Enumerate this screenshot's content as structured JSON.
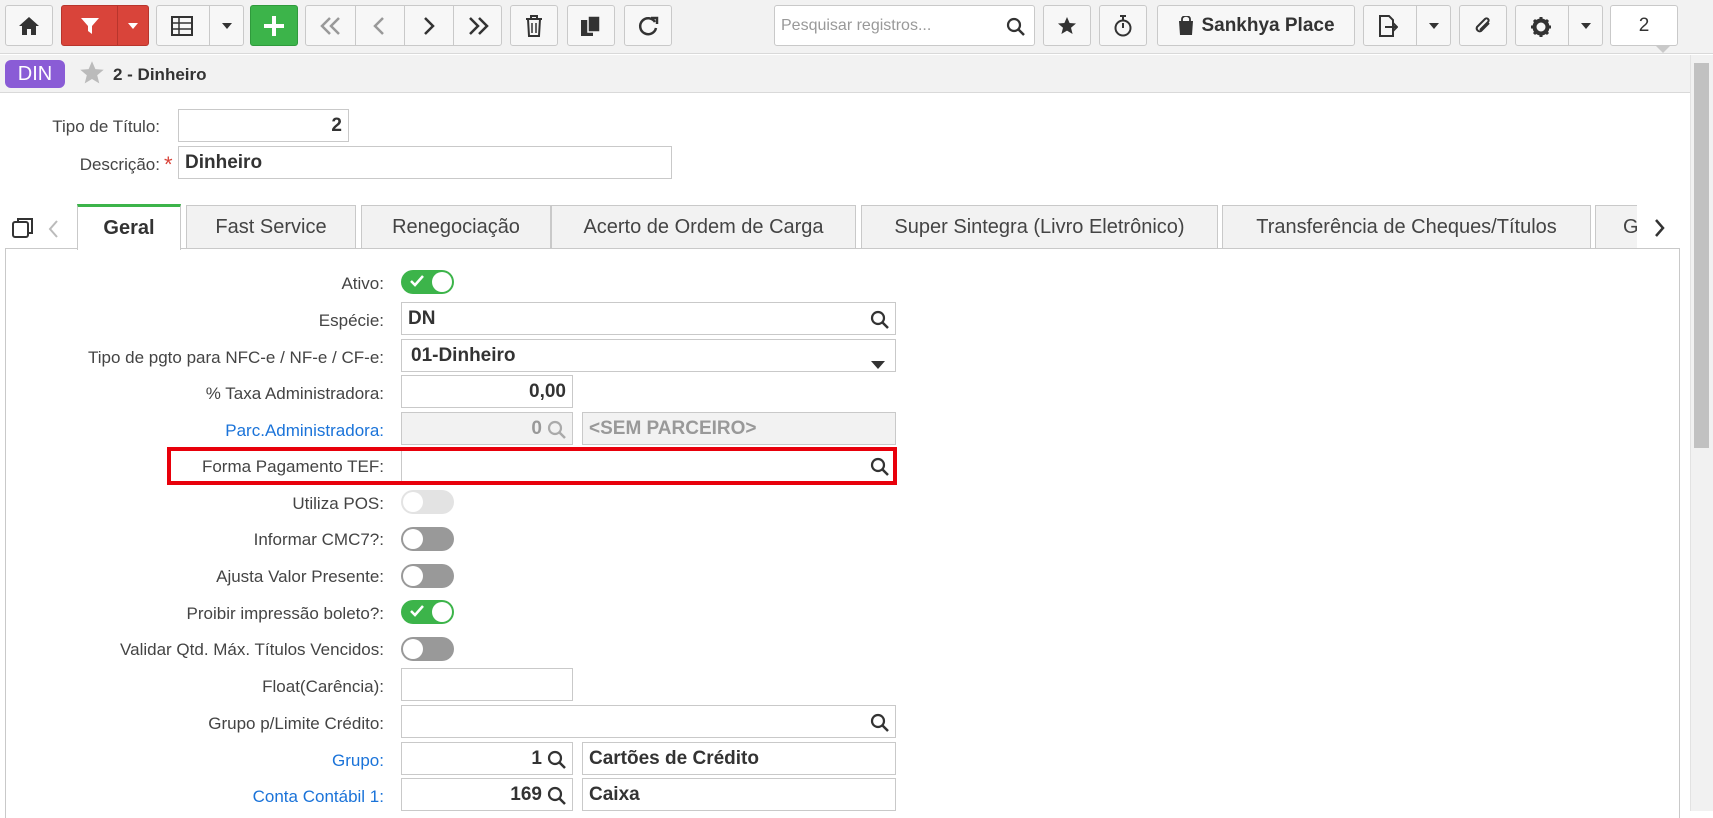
{
  "toolbar": {
    "search_placeholder": "Pesquisar registros...",
    "place_label": "Sankhya Place",
    "page_number": "2"
  },
  "record": {
    "badge": "DIN",
    "title": "2 - Dinheiro"
  },
  "header_form": {
    "tipo_label": "Tipo de Título:",
    "tipo_value": "2",
    "descricao_label": "Descrição:",
    "descricao_value": "Dinheiro",
    "required_mark": "*"
  },
  "tabs": [
    {
      "label": "Geral"
    },
    {
      "label": "Fast Service"
    },
    {
      "label": "Renegociação"
    },
    {
      "label": "Acerto de Ordem de Carga"
    },
    {
      "label": "Super Sintegra (Livro Eletrônico)"
    },
    {
      "label": "Transferência de Cheques/Títulos"
    },
    {
      "label": "G"
    }
  ],
  "form": {
    "ativo_label": "Ativo:",
    "especie_label": "Espécie:",
    "especie_value": "DN",
    "tipo_pgto_label": "Tipo de pgto para NFC-e / NF-e / CF-e:",
    "tipo_pgto_value": "01-Dinheiro",
    "taxa_label": "% Taxa Administradora:",
    "taxa_value": "0,00",
    "parc_label": "Parc.Administradora:",
    "parc_value": "0",
    "parc_name": "<SEM PARCEIRO>",
    "tef_label": "Forma Pagamento TEF:",
    "tef_value": "",
    "pos_label": "Utiliza POS:",
    "cmc7_label": "Informar CMC7?:",
    "ajusta_label": "Ajusta Valor Presente:",
    "boleto_label": "Proibir impressão boleto?:",
    "validar_label": "Validar Qtd. Máx. Títulos Vencidos:",
    "float_label": "Float(Carência):",
    "float_value": "",
    "grupo_limite_label": "Grupo p/Limite Crédito:",
    "grupo_limite_value": "",
    "grupo_label": "Grupo:",
    "grupo_value": "1",
    "grupo_name": "Cartões de Crédito",
    "conta_label": "Conta Contábil 1:",
    "conta_value": "169",
    "conta_name": "Caixa"
  },
  "toggles": {
    "ativo": true,
    "utiliza_pos": false,
    "informar_cmc7": false,
    "ajusta_valor_presente": false,
    "proibir_boleto": true,
    "validar_qtd": false
  },
  "colors": {
    "accent_green": "#3cb44a",
    "filter_red": "#d9443a",
    "badge_purple": "#8a5cd6",
    "link_blue": "#1a73d9",
    "highlight_red": "#e8000b"
  }
}
